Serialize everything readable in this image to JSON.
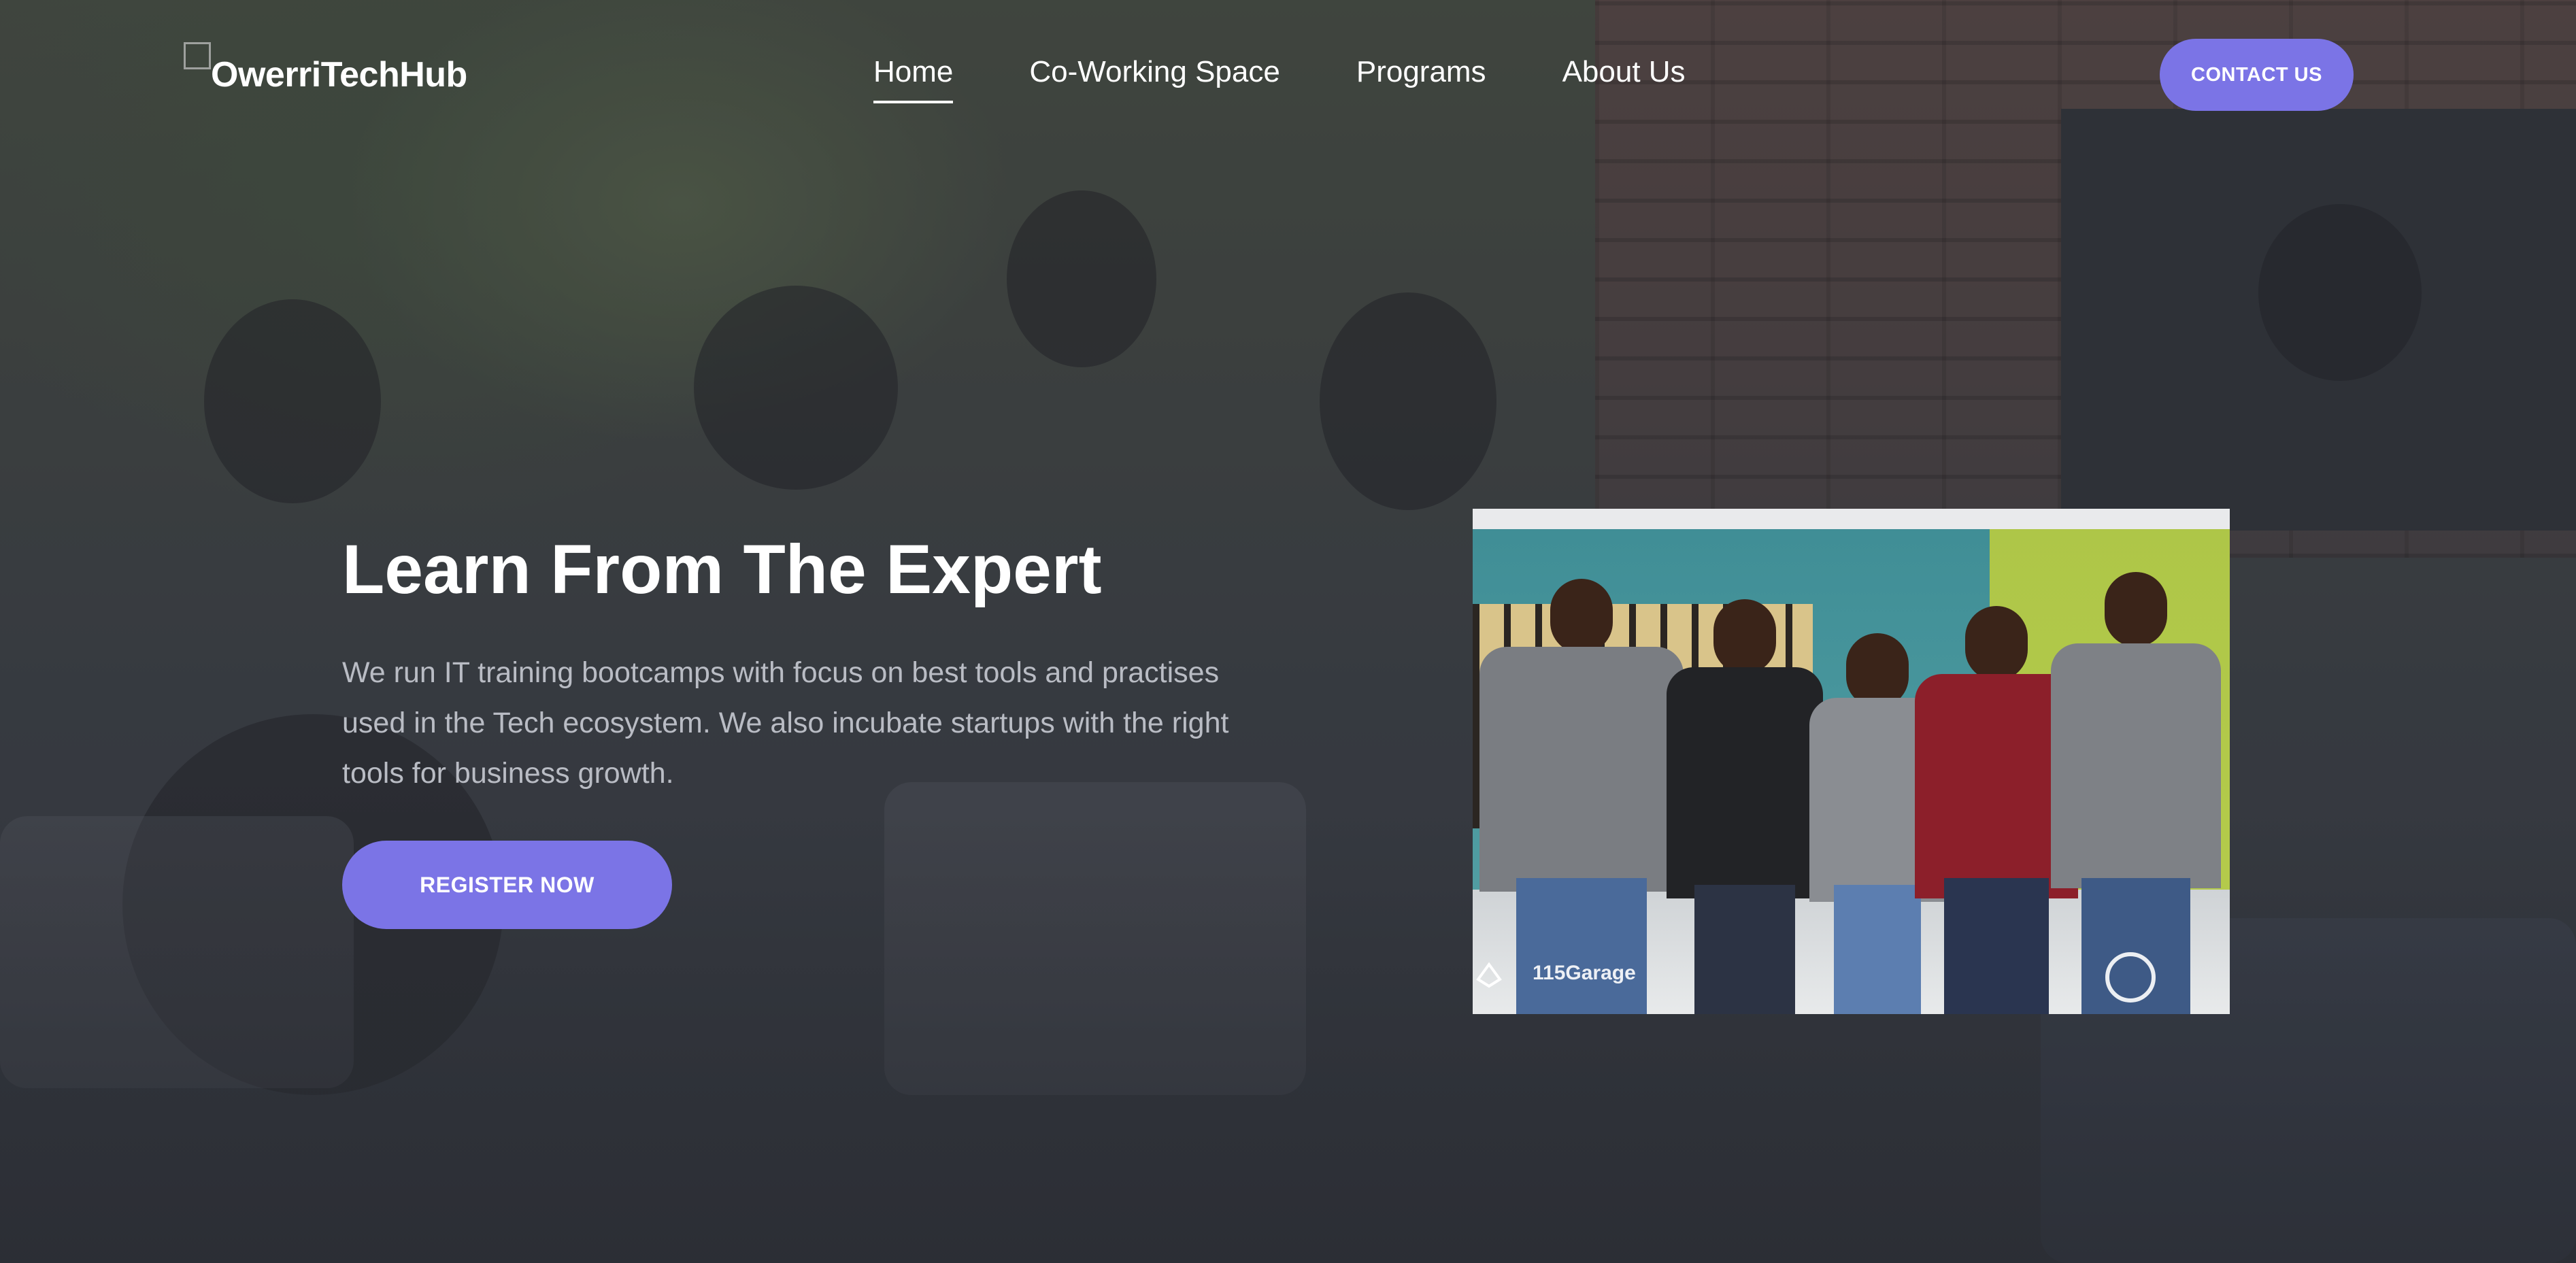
{
  "brand": {
    "name": "OwerriTechHub",
    "logo_icon": "broken-image-icon"
  },
  "nav": {
    "items": [
      {
        "label": "Home",
        "active": true
      },
      {
        "label": "Co-Working Space",
        "active": false
      },
      {
        "label": "Programs",
        "active": false
      },
      {
        "label": "About Us",
        "active": false
      }
    ]
  },
  "header": {
    "contact_label": "CONTACT US"
  },
  "hero": {
    "title": "Learn From The Expert",
    "description": "We run IT training bootcamps with focus on best tools and practises used in the Tech ecosystem. We also incubate startups with the right tools for business growth.",
    "register_label": "REGISTER NOW"
  },
  "team_photo": {
    "watermark": "115Garage"
  },
  "colors": {
    "accent": "#7b74e6",
    "text_primary": "#ffffff",
    "text_muted": "#b9bcc4",
    "background_overlay": "#3b3e45"
  }
}
